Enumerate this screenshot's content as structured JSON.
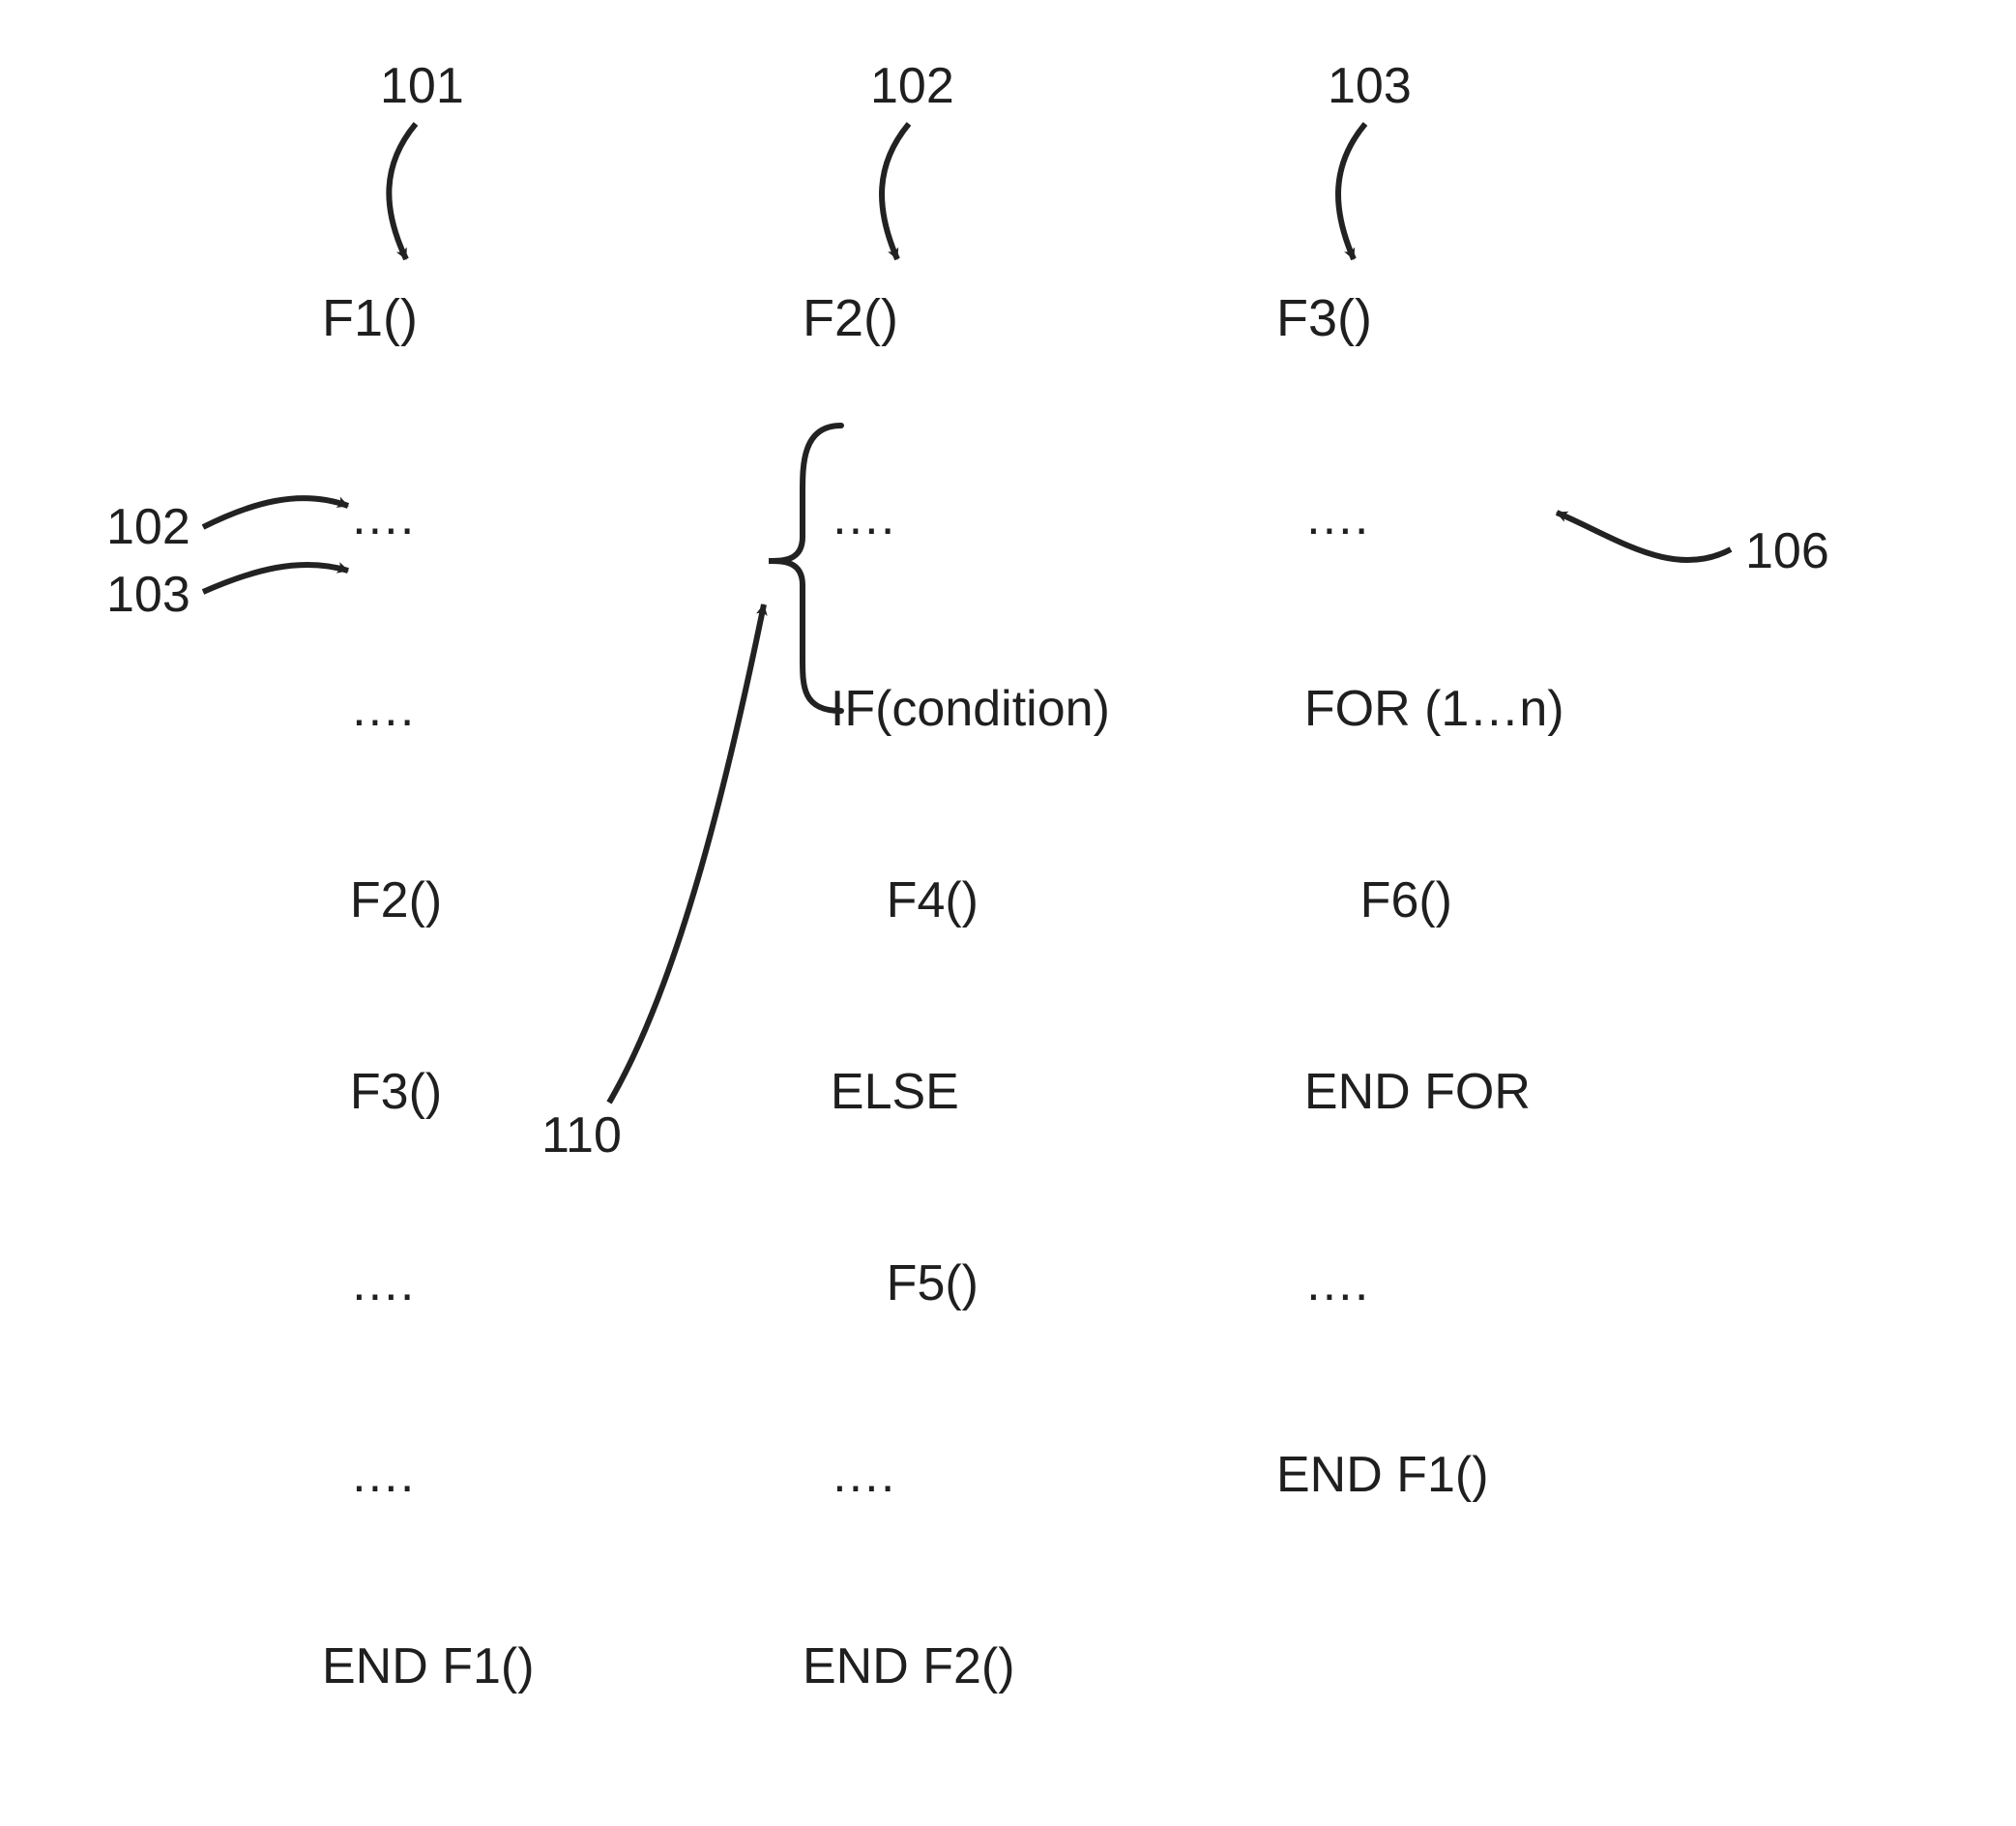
{
  "labels": {
    "top_101": "101",
    "top_102": "102",
    "top_103": "103",
    "side_102": "102",
    "side_103": "103",
    "side_110": "110",
    "side_106": "106"
  },
  "blocks": {
    "b1": {
      "header": "F1()",
      "lines": [
        "  ….",
        "  ….",
        "  F2()",
        "  F3()",
        "  ….",
        "  ….",
        "END F1()"
      ]
    },
    "b2": {
      "header": "F2()",
      "lines": [
        "  ….",
        "  IF(condition)",
        "      F4()",
        "  ELSE",
        "      F5()",
        "  ….",
        "END F2()"
      ]
    },
    "b3": {
      "header": "F3()",
      "lines": [
        "  ….",
        "  FOR (1…n)",
        "      F6()",
        "  END FOR",
        "  ….",
        "END F1()"
      ]
    }
  },
  "chart_data": {
    "type": "diagram",
    "description": "Pseudocode listing of three functions with reference-number arrows",
    "functions": [
      {
        "ref": 101,
        "name": "F1",
        "body": [
          "….",
          "….",
          "F2()",
          "F3()",
          "….",
          "….",
          "END F1()"
        ],
        "calls": [
          {
            "ref": 102,
            "line_text": "F2()"
          },
          {
            "ref": 103,
            "line_text": "F3()"
          }
        ]
      },
      {
        "ref": 102,
        "name": "F2",
        "body": [
          "….",
          "IF(condition)",
          "F4()",
          "ELSE",
          "F5()",
          "….",
          "END F2()"
        ],
        "branch_ref": 110
      },
      {
        "ref": 103,
        "name": "F3",
        "body": [
          "….",
          "FOR (1…n)",
          "F6()",
          "END FOR",
          "….",
          "END F1()"
        ],
        "calls": [
          {
            "ref": 106,
            "line_text": "F6()"
          }
        ]
      }
    ]
  }
}
